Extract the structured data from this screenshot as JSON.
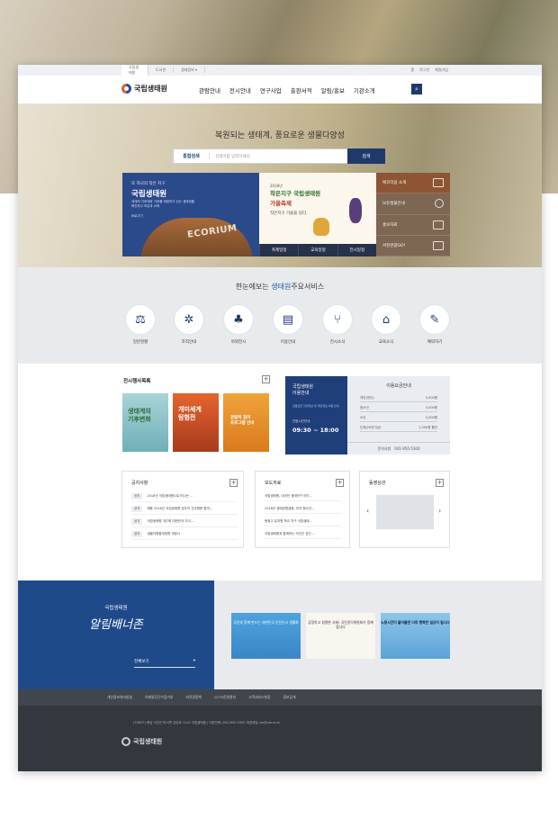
{
  "util": {
    "tabs": [
      "국립생태원",
      "도서관",
      "생태정보"
    ],
    "right": [
      "홈",
      "로그인",
      "회원가입"
    ]
  },
  "header": {
    "logo": "국립생태원",
    "menu": [
      "관람안내",
      "전시안내",
      "연구사업",
      "출판서적",
      "알림/홍보",
      "기관소개"
    ]
  },
  "hero": {
    "slogan": "복원되는 생태계, 풍요로운 생물다양성",
    "search_label": "통합검색",
    "search_placeholder": "검색어를 입력하세요.",
    "search_button": "검색"
  },
  "banner1": {
    "sub": "또 하나의 작은 지구",
    "title": "국립생태원",
    "desc": "세계의 기후대와 기후를 재현하고 있는 생태계를 확인하고 보존과 교육",
    "more": "바로가기",
    "word": "ECORIUM"
  },
  "banner2": {
    "year": "2018년",
    "line1": "작은지구 국립생태원",
    "line2": "가을축제",
    "hand": "작은지구 가을을 담다.",
    "tabs": [
      "축제일정",
      "교육일정",
      "전시일정"
    ]
  },
  "banner3": {
    "items": [
      "에코리움 소개",
      "보유생물안내",
      "홍보자료",
      "서천관광GO!"
    ]
  },
  "services": {
    "title_pre": "한눈에보는",
    "title_hl": "생태원",
    "title_post": "주요서비스",
    "items": [
      "일반현황",
      "조직안내",
      "야외전시",
      "이용안내",
      "전시소식",
      "교육소식",
      "예약하기"
    ]
  },
  "exhibits": {
    "title": "전시행사목록",
    "books": [
      {
        "l1": "생태계의",
        "l2": "기후변화"
      },
      {
        "l1": "개미세계",
        "l2": "탐험전"
      },
      {
        "l1": "관람객 참여",
        "l2": "프로그램 안내"
      }
    ]
  },
  "usage": {
    "left_title1": "국립생태원",
    "left_title2": "이용안내",
    "left_desc": "관람요금 할인대상 및 개인정보 이용 안내",
    "hours_label": "관람시간안내",
    "hours": "09:30 ~ 18:00",
    "right_title": "이용요금안내",
    "fees": [
      {
        "k": "개인(대인)",
        "v": "5,000원"
      },
      {
        "k": "청소년",
        "v": "3,000원"
      },
      {
        "k": "소인",
        "v": "2,000원"
      },
      {
        "k": "단체(20인이상)",
        "v": "1,000원 할인"
      }
    ],
    "tel_label": "문의사항",
    "tel": "041-950-5300"
  },
  "notice": {
    "title": "공지사항",
    "rows": [
      {
        "tag": "공지",
        "text": "2018년 국립생태원으로 떠나는 ..."
      },
      {
        "tag": "공지",
        "text": "채용 2018년 국립생태원 공무직 신규채용 합격..."
      },
      {
        "tag": "공지",
        "text": "국립생태원 '제7회 대한민국 지식..."
      },
      {
        "tag": "공지",
        "text": "생물자원통계청원 개정사"
      }
    ]
  },
  "press": {
    "title": "보도자료",
    "rows": [
      "국립생태원, 대국민 생태연구 아이...",
      "2018년 생태공원캠핑, 전국 청소년...",
      "충청고 유치원 학교 지구 국립생태...",
      "국립생태원과 함께하는 서천군 성인..."
    ]
  },
  "video": {
    "title": "동영상관"
  },
  "banner_zone": {
    "name": "국립생태원",
    "script": "알림배너존",
    "select": "전체보기",
    "promos": [
      "국민과 함께 만드는 대한민국 안전신고 생활화",
      "공정하고 청렴한 사회! 국민권익위원회가 함께 합니다",
      "노동시간이 줄어들면 더욱 행복한 일상이 됩니다"
    ]
  },
  "footer": {
    "nav": [
      "개인정보처리방침",
      "이메일무단수집거부",
      "저작권정책",
      "CCTV운영관리",
      "고객서비스헌장",
      "정보공개"
    ],
    "addr": "(33657) 충남 서천군 마서면 금강로 1210 국립생태원 | 대표전화 (041)950-5300 대표메일 nie@nie.re.kr",
    "logo": "국립생태원"
  }
}
